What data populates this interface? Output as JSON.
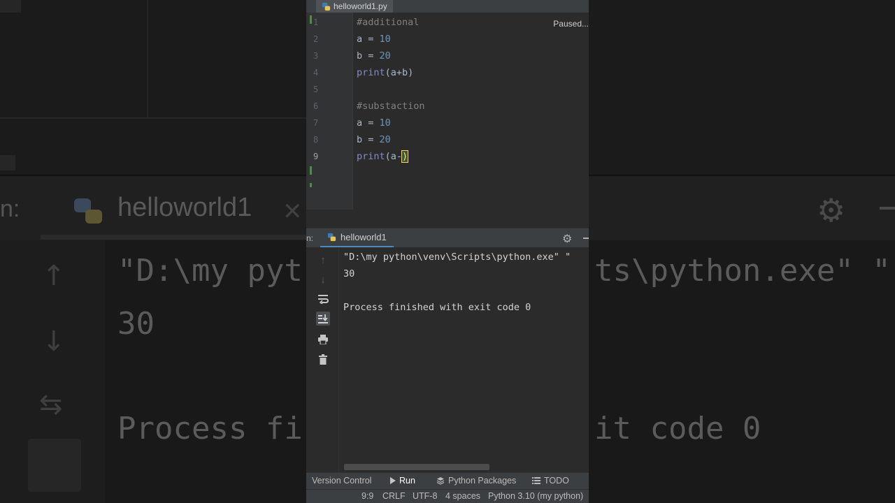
{
  "editor": {
    "tab_label": "helloworld1.py",
    "status_text": "Paused...",
    "lines": [
      {
        "num": "1",
        "tokens": [
          {
            "cls": "c-comment",
            "text": "#additional"
          }
        ]
      },
      {
        "num": "2",
        "tokens": [
          {
            "cls": "c-plain",
            "text": "a = "
          },
          {
            "cls": "c-num",
            "text": "10"
          }
        ]
      },
      {
        "num": "3",
        "tokens": [
          {
            "cls": "c-plain",
            "text": "b = "
          },
          {
            "cls": "c-num",
            "text": "20"
          }
        ]
      },
      {
        "num": "4",
        "tokens": [
          {
            "cls": "c-fn",
            "text": "print"
          },
          {
            "cls": "c-paren",
            "text": "(a+b)"
          }
        ]
      },
      {
        "num": "5",
        "tokens": []
      },
      {
        "num": "6",
        "tokens": [
          {
            "cls": "c-comment",
            "text": "#substaction"
          }
        ]
      },
      {
        "num": "7",
        "tokens": [
          {
            "cls": "c-plain",
            "text": "a = "
          },
          {
            "cls": "c-num",
            "text": "10"
          }
        ]
      },
      {
        "num": "8",
        "tokens": [
          {
            "cls": "c-plain",
            "text": "b = "
          },
          {
            "cls": "c-num",
            "text": "20"
          }
        ]
      },
      {
        "num": "9",
        "tokens": [
          {
            "cls": "c-fn",
            "text": "print"
          },
          {
            "cls": "c-paren",
            "text": "(a-"
          },
          {
            "cls": "caret-paren",
            "text": ")"
          }
        ]
      }
    ]
  },
  "run_panel": {
    "prefix": "n:",
    "tab_label": "helloworld1",
    "gear_glyph": "⚙",
    "output": {
      "command": "\"D:\\my python\\venv\\Scripts\\python.exe\" \"",
      "result": "30",
      "finish": "Process finished with exit code 0"
    }
  },
  "bottom_tools": {
    "version_control": "Version Control",
    "run": "Run",
    "python_packages": "Python Packages",
    "todo": "TODO"
  },
  "status_bar": {
    "position": "9:9",
    "line_sep": "CRLF",
    "encoding": "UTF-8",
    "indent": "4 spaces",
    "interpreter": "Python 3.10 (my python)"
  },
  "background": {
    "tab_label": "helloworld1",
    "run_label": "n:",
    "command": "\"D:\\my pyt",
    "command_right": "ts\\python.exe\" \"",
    "result": "30",
    "finish_left": "Process fi",
    "finish_right": "it code 0"
  },
  "colors": {
    "accent": "#4a88c7",
    "comment": "#808080",
    "number": "#6897bb",
    "builtin": "#8888c6",
    "panel": "#3c3f41",
    "editor_bg": "#2b2b2b"
  }
}
